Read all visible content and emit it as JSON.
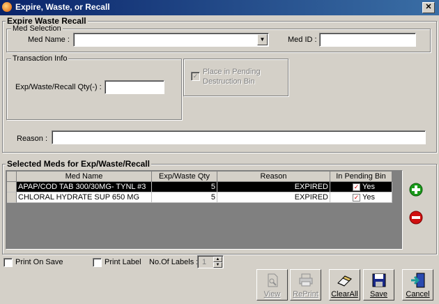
{
  "window": {
    "title": "Expire, Waste, or Recall",
    "close": "✕"
  },
  "main_group": {
    "title": "Expire Waste Recall"
  },
  "med_selection": {
    "title": "Med Selection",
    "med_name_label": "Med Name :",
    "med_name_value": "",
    "med_id_label": "Med ID :",
    "med_id_value": ""
  },
  "transaction": {
    "title": "Transaction Info",
    "qty_label": "Exp/Waste/Recall Qty(-) :",
    "qty_value": "",
    "pending_checkbox_label_1": "Place in Pending",
    "pending_checkbox_label_2": "Destruction Bin",
    "pending_checked": true
  },
  "reason": {
    "label": "Reason :",
    "value": ""
  },
  "selected_meds": {
    "title": "Selected Meds for Exp/Waste/Recall",
    "columns": [
      "Med Name",
      "Exp/Waste Qty",
      "Reason",
      "In Pending Bin"
    ],
    "rows": [
      {
        "med_name": "APAP/COD TAB 300/30MG- TYNL #3",
        "qty": "5",
        "reason": "EXPIRED",
        "pending": "Yes",
        "selected": true
      },
      {
        "med_name": "CHLORAL HYDRATE SUP 650 MG",
        "qty": "5",
        "reason": "EXPIRED",
        "pending": "Yes",
        "selected": false
      }
    ]
  },
  "side_buttons": {
    "add_icon": "plus-circle",
    "remove_icon": "minus-circle",
    "add_color": "#1a9a1a",
    "remove_color": "#d01010"
  },
  "options": {
    "print_on_save": "Print On Save",
    "print_label": "Print Label",
    "num_labels_label": "No.Of Labels :",
    "num_labels_value": "1"
  },
  "toolbar": {
    "view": "View",
    "reprint": "RePrint",
    "clear_all": "ClearAll",
    "save": "Save",
    "cancel": "Cancel"
  }
}
